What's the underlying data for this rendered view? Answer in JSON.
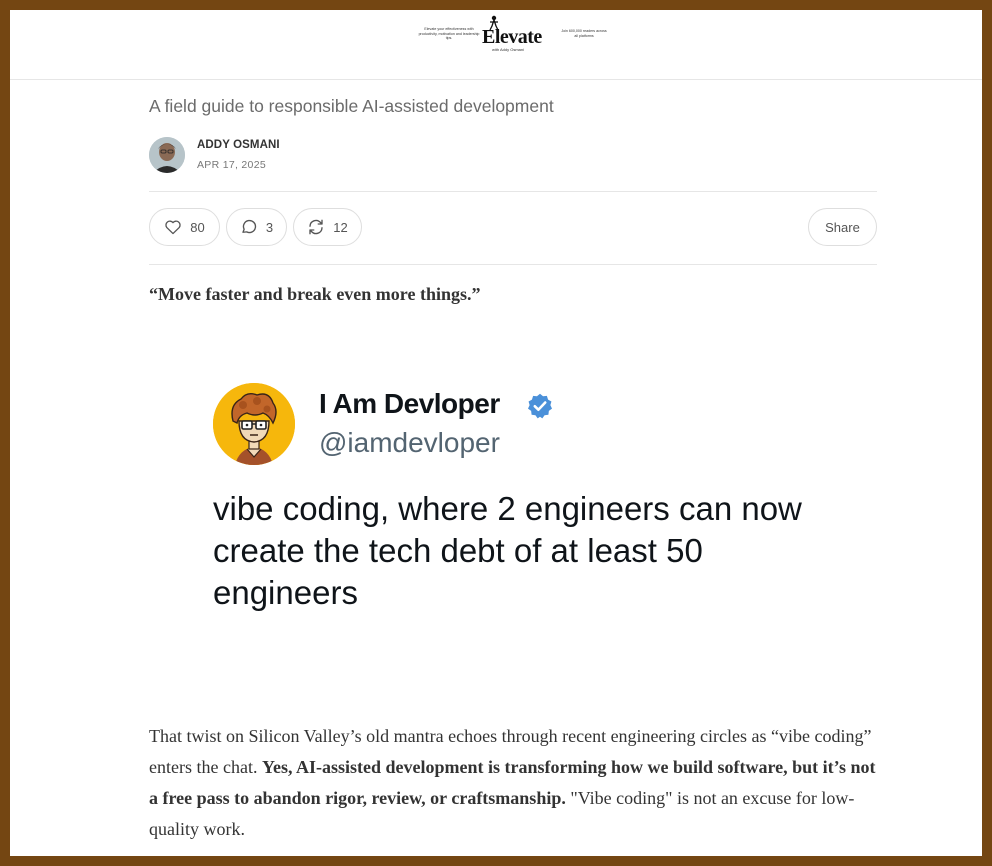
{
  "masthead": {
    "tagline_left": "Elevate your effectiveness with productivity, motivation and leadership tips.",
    "logo_text": "Elevate",
    "logo_sub": "with Addy Osmani",
    "tagline_right": "Join 600,000 readers across all platforms"
  },
  "post": {
    "subtitle": "A field guide to responsible AI-assisted development",
    "author": "ADDY OSMANI",
    "date": "APR 17, 2025"
  },
  "actions": {
    "likes": "80",
    "comments": "3",
    "restacks": "12",
    "share_label": "Share"
  },
  "quote": "“Move faster and break even more things.”",
  "tweet": {
    "name": "I Am Devloper",
    "handle": "@iamdevloper",
    "text": "vibe coding, where 2 engineers can now create the tech debt of at least 50 engineers"
  },
  "body": {
    "part1": "That twist on Silicon Valley’s old mantra echoes through recent engineering circles as “vibe coding” enters the chat. ",
    "part2_bold": "Yes, AI-assisted development is transforming how we build software, but it’s not a free pass to abandon rigor, review, or craftsmanship.",
    "part3": " \"Vibe coding\" is not an excuse for low-quality work."
  },
  "colors": {
    "frame_border": "#744612",
    "verified_blue": "#1d9bf0",
    "avatar_yellow": "#f6b70c"
  }
}
